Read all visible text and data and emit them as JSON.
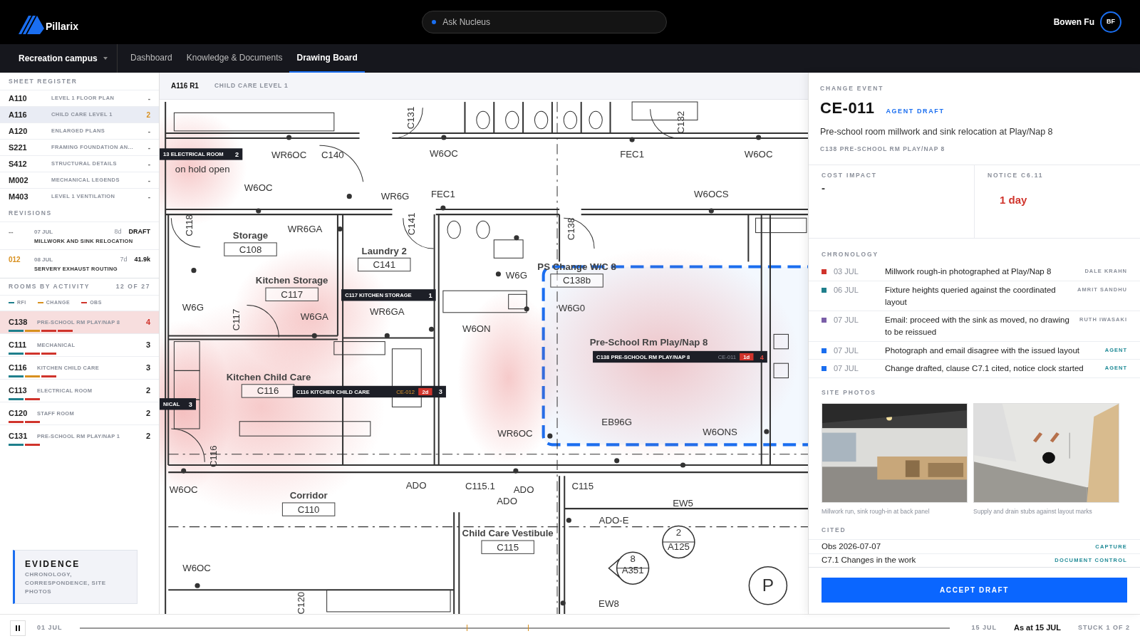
{
  "header": {
    "logo": "Pillarix",
    "search": {
      "placeholder": "Ask Nucleus"
    },
    "user": {
      "name": "Bowen Fu",
      "initials": "BF"
    }
  },
  "nav": {
    "project": "Recreation campus",
    "tabs": [
      {
        "label": "Dashboard",
        "selected": false
      },
      {
        "label": "Knowledge & Documents",
        "selected": false
      },
      {
        "label": "Drawing Board",
        "selected": true
      }
    ]
  },
  "sidebar": {
    "sheet_register": {
      "title": "SHEET REGISTER",
      "sheets": [
        {
          "code": "A110",
          "title": "LEVEL 1 FLOOR PLAN",
          "count": "-",
          "selected": false
        },
        {
          "code": "A116",
          "title": "CHILD CARE LEVEL 1",
          "count": "2",
          "selected": true
        },
        {
          "code": "A120",
          "title": "ENLARGED PLANS",
          "count": "-",
          "selected": false
        },
        {
          "code": "S221",
          "title": "FRAMING FOUNDATION AN...",
          "count": "-",
          "selected": false
        },
        {
          "code": "S412",
          "title": "STRUCTURAL DETAILS",
          "count": "-",
          "selected": false
        },
        {
          "code": "M002",
          "title": "MECHANICAL LEGENDS",
          "count": "-",
          "selected": false
        },
        {
          "code": "M403",
          "title": "LEVEL 1 VENTILATION",
          "count": "-",
          "selected": false
        }
      ]
    },
    "revisions": {
      "title": "REVISIONS",
      "items": [
        {
          "rev": "--",
          "kind": "draft",
          "date": "07 JUL",
          "age": "8d",
          "value": "DRAFT",
          "title": "MILLWORK AND SINK RELOCATION"
        },
        {
          "rev": "012",
          "kind": "issued",
          "date": "08 JUL",
          "age": "7d",
          "value": "41.9k",
          "title": "SERVERY EXHAUST ROUTING"
        }
      ]
    },
    "rooms": {
      "title": "ROOMS BY ACTIVITY",
      "count": "12 OF 27",
      "legend": [
        {
          "label": "RFI",
          "color": "#1f7f8c"
        },
        {
          "label": "CHANGE",
          "color": "#d8901f"
        },
        {
          "label": "OBS",
          "color": "#d0342c"
        }
      ],
      "items": [
        {
          "code": "C138",
          "name": "PRE-SCHOOL RM PLAY/NAP 8",
          "count": "4",
          "selected": true,
          "marks": [
            {
              "color": "#1f7f8c"
            },
            {
              "color": "#d8901f"
            },
            {
              "color": "#d0342c"
            },
            {
              "color": "#d0342c"
            }
          ]
        },
        {
          "code": "C111",
          "name": "MECHANICAL",
          "count": "3",
          "selected": false,
          "marks": [
            {
              "color": "#1f7f8c"
            },
            {
              "color": "#d0342c"
            },
            {
              "color": "#d0342c"
            }
          ]
        },
        {
          "code": "C116",
          "name": "KITCHEN CHILD CARE",
          "count": "3",
          "selected": false,
          "marks": [
            {
              "color": "#1f7f8c"
            },
            {
              "color": "#d8901f"
            },
            {
              "color": "#d0342c"
            }
          ]
        },
        {
          "code": "C113",
          "name": "ELECTRICAL ROOM",
          "count": "2",
          "selected": false,
          "marks": [
            {
              "color": "#1f7f8c"
            },
            {
              "color": "#d0342c"
            }
          ]
        },
        {
          "code": "C120",
          "name": "STAFF ROOM",
          "count": "2",
          "selected": false,
          "marks": [
            {
              "color": "#d0342c"
            },
            {
              "color": "#d0342c"
            }
          ]
        },
        {
          "code": "C131",
          "name": "PRE-SCHOOL RM PLAY/NAP 1",
          "count": "2",
          "selected": false,
          "marks": [
            {
              "color": "#1f7f8c"
            },
            {
              "color": "#d0342c"
            }
          ]
        }
      ]
    },
    "evidence": {
      "title": "EVIDENCE",
      "text": "CHRONOLOGY, CORRESPONDENCE, SITE PHOTOS"
    }
  },
  "drawing": {
    "sheet": "A116 R1",
    "title": "CHILD CARE LEVEL 1",
    "labels": [
      {
        "text": "C131",
        "kind": "mark"
      },
      {
        "text": "C132",
        "kind": "mark"
      },
      {
        "text": "WR6OC",
        "kind": "mark"
      },
      {
        "text": "C140",
        "kind": "mark"
      },
      {
        "text": "W6OC",
        "kind": "mark"
      },
      {
        "text": "FEC1",
        "kind": "mark"
      },
      {
        "text": "W6OC",
        "kind": "mark"
      },
      {
        "text": "on hold open",
        "kind": "mark"
      },
      {
        "text": "W6OC",
        "kind": "mark"
      },
      {
        "text": "WR6G",
        "kind": "mark"
      },
      {
        "text": "FEC1",
        "kind": "mark"
      },
      {
        "text": "W6OCS",
        "kind": "mark"
      },
      {
        "text": "C118",
        "kind": "mark"
      },
      {
        "text": "C141",
        "kind": "mark"
      },
      {
        "text": "C138",
        "kind": "mark"
      },
      {
        "text": "Storage",
        "kind": "name"
      },
      {
        "text": "C108",
        "kind": "number"
      },
      {
        "text": "WR6GA",
        "kind": "mark"
      },
      {
        "text": "Laundry 2",
        "kind": "name"
      },
      {
        "text": "C141",
        "kind": "number"
      },
      {
        "text": "Kitchen Storage",
        "kind": "name"
      },
      {
        "text": "C117",
        "kind": "number"
      },
      {
        "text": "PS Change W/C 8",
        "kind": "name"
      },
      {
        "text": "C138b",
        "kind": "number"
      },
      {
        "text": "W6G",
        "kind": "mark"
      },
      {
        "text": "W6G",
        "kind": "mark"
      },
      {
        "text": "C117",
        "kind": "mark"
      },
      {
        "text": "W6GA",
        "kind": "mark"
      },
      {
        "text": "WR6GA",
        "kind": "mark"
      },
      {
        "text": "W6G0",
        "kind": "mark"
      },
      {
        "text": "W6ON",
        "kind": "mark"
      },
      {
        "text": "Pre-School Rm Play/Nap 8",
        "kind": "name"
      },
      {
        "text": "Kitchen Child Care",
        "kind": "name"
      },
      {
        "text": "C116",
        "kind": "number"
      },
      {
        "text": "EB96G",
        "kind": "mark"
      },
      {
        "text": "WR6OC",
        "kind": "mark"
      },
      {
        "text": "W6ONS",
        "kind": "mark"
      },
      {
        "text": "C116",
        "kind": "mark"
      },
      {
        "text": "W6OC",
        "kind": "mark"
      },
      {
        "text": "ADO",
        "kind": "mark"
      },
      {
        "text": "C115.1",
        "kind": "mark"
      },
      {
        "text": "ADO",
        "kind": "mark"
      },
      {
        "text": "ADO",
        "kind": "mark"
      },
      {
        "text": "C115",
        "kind": "mark"
      },
      {
        "text": "EW5",
        "kind": "mark"
      },
      {
        "text": "Corridor",
        "kind": "name"
      },
      {
        "text": "C110",
        "kind": "number"
      },
      {
        "text": "ADO-E",
        "kind": "mark"
      },
      {
        "text": "2",
        "kind": "mark"
      },
      {
        "text": "A125",
        "kind": "mark"
      },
      {
        "text": "Child Care Vestibule",
        "kind": "name"
      },
      {
        "text": "C115",
        "kind": "number"
      },
      {
        "text": "8",
        "kind": "mark"
      },
      {
        "text": "A351",
        "kind": "mark"
      },
      {
        "text": "W6OC",
        "kind": "mark"
      },
      {
        "text": "C120",
        "kind": "mark"
      },
      {
        "text": "P",
        "kind": "grid"
      },
      {
        "text": "EW8",
        "kind": "mark"
      }
    ],
    "tags": [
      {
        "label": "13 ELECTRICAL ROOM",
        "count": "2",
        "selected": false
      },
      {
        "label": "C117 KITCHEN STORAGE",
        "count": "1",
        "selected": false
      },
      {
        "label": "C116 KITCHEN CHILD CARE",
        "ce": "CE-012",
        "ce_draft": false,
        "days": "2d",
        "count": "3",
        "selected": false
      },
      {
        "label": "C138 PRE-SCHOOL RM PLAY/NAP 8",
        "ce": "CE-011",
        "ce_draft": true,
        "days": "1d",
        "count": "4",
        "selected": true
      },
      {
        "label": "NICAL",
        "count": "3",
        "selected": false
      }
    ]
  },
  "change_event": {
    "eyebrow": "CHANGE EVENT",
    "id": "CE-011",
    "status": "AGENT DRAFT",
    "summary": "Pre-school room millwork and sink relocation at Play/Nap 8",
    "room": "C138 PRE-SCHOOL RM PLAY/NAP 8",
    "stats": [
      {
        "label": "COST IMPACT",
        "value": "-",
        "alert": false
      },
      {
        "label": "NOTICE C6.11",
        "value": "1 day",
        "alert": true
      }
    ],
    "chronology": {
      "title": "CHRONOLOGY",
      "items": [
        {
          "date": "03 JUL",
          "text": "Millwork rough-in photographed at Play/Nap 8",
          "author": "DALE KRAHN",
          "agent": false,
          "color": "#d0342c"
        },
        {
          "date": "06 JUL",
          "text": "Fixture heights queried against the coordinated layout",
          "author": "AMRIT SANDHU",
          "agent": false,
          "color": "#1f7f8c"
        },
        {
          "date": "07 JUL",
          "text": "Email: proceed with the sink as moved, no drawing to be reissued",
          "author": "RUTH IWASAKI",
          "agent": false,
          "color": "#7a5ea8"
        },
        {
          "date": "07 JUL",
          "text": "Photograph and email disagree with the issued layout",
          "author": "AGENT",
          "agent": true,
          "color": "#1a6ef0"
        },
        {
          "date": "07 JUL",
          "text": "Change drafted, clause C7.1 cited, notice clock started",
          "author": "AGENT",
          "agent": true,
          "color": "#1a6ef0"
        }
      ]
    },
    "photos": {
      "title": "SITE PHOTOS",
      "items": [
        {
          "kind": "picture",
          "caption": "Millwork run, sink rough-in at back panel"
        },
        {
          "kind": "picture",
          "caption": "Supply and drain stubs against layout marks"
        }
      ]
    },
    "cited": {
      "title": "CITED",
      "items": [
        {
          "text": "Obs 2026-07-07",
          "source": "CAPTURE"
        },
        {
          "text": "C7.1 Changes in the work",
          "source": "DOCUMENT CONTROL"
        }
      ]
    },
    "action": "ACCEPT DRAFT"
  },
  "timeline": {
    "playing": true,
    "start": "01 JUL",
    "end": "15 JUL",
    "as_at": "As at 15 JUL",
    "status": "STUCK 1 OF 2"
  }
}
